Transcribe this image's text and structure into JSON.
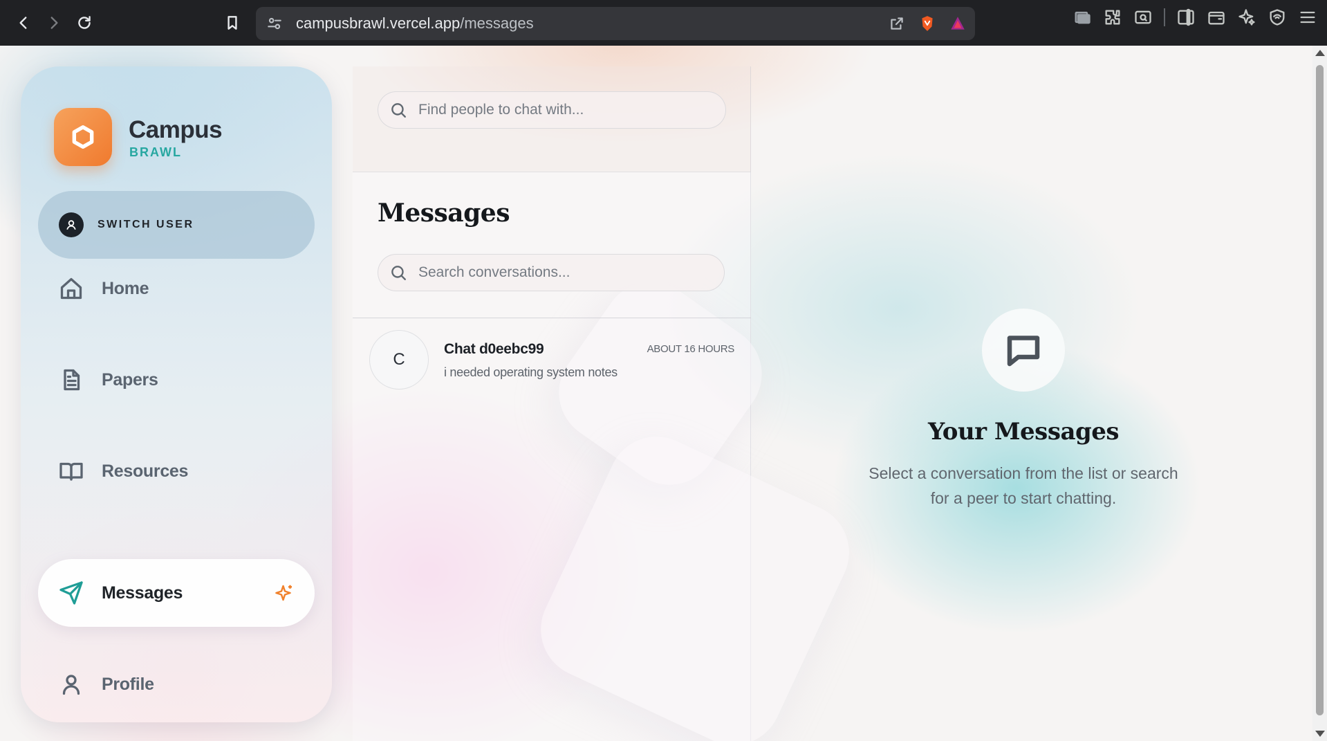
{
  "browser": {
    "url_host": "campusbrawl.vercel.app",
    "url_path": "/messages"
  },
  "sidebar": {
    "brand_title": "Campus",
    "brand_subtitle": "BRAWL",
    "switch_user_label": "SWITCH USER",
    "items": [
      {
        "label": "Home",
        "icon": "home-icon",
        "active": false
      },
      {
        "label": "Papers",
        "icon": "document-icon",
        "active": false
      },
      {
        "label": "Resources",
        "icon": "book-icon",
        "active": false
      },
      {
        "label": "Messages",
        "icon": "send-icon",
        "active": true
      },
      {
        "label": "Profile",
        "icon": "user-icon",
        "active": false
      }
    ]
  },
  "people_search": {
    "placeholder": "Find people to chat with..."
  },
  "messages_panel": {
    "title": "Messages",
    "search_placeholder": "Search conversations...",
    "conversations": [
      {
        "avatar_letter": "C",
        "name": "Chat d0eebc99",
        "time": "ABOUT 16 HOURS",
        "preview": "i needed operating system notes"
      }
    ]
  },
  "empty_state": {
    "title": "Your Messages",
    "description": "Select a conversation from the list or search for a peer to start chatting."
  },
  "colors": {
    "accent_teal": "#27a7a1",
    "accent_orange": "#f07a2e"
  }
}
